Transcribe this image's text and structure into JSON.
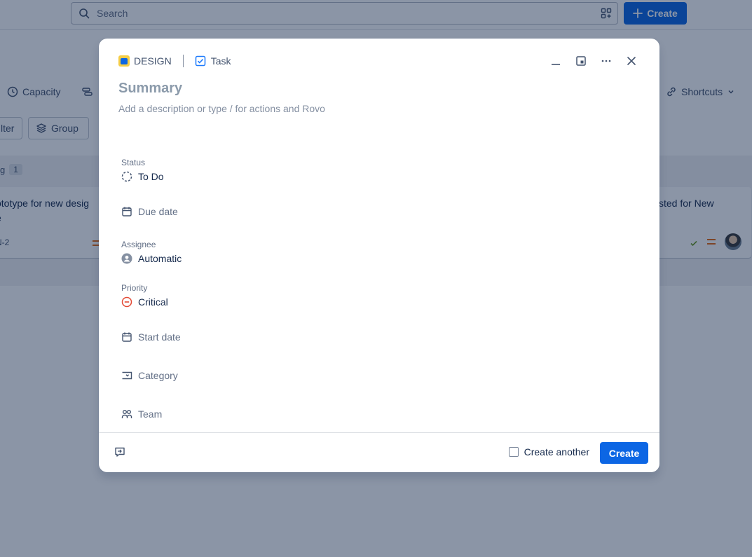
{
  "topbar": {
    "search_placeholder": "Search",
    "create_label": "Create"
  },
  "background": {
    "capacity_label": "Capacity",
    "shortcuts_label": "Shortcuts",
    "filter_label": "lter",
    "group_label": "Group",
    "column_label": "g",
    "column_count": "1",
    "card_left": {
      "line1": "ototype for new desig",
      "line2": "e",
      "key": "N-2"
    },
    "card_right": {
      "line1": "sted for New"
    }
  },
  "modal": {
    "project_name": "DESIGN",
    "issue_type": "Task",
    "summary_placeholder": "Summary",
    "description_placeholder": "Add a description or type / for actions and Rovo",
    "fields": {
      "status": {
        "label": "Status",
        "value": "To Do"
      },
      "due_date": {
        "value": "Due date"
      },
      "assignee": {
        "label": "Assignee",
        "value": "Automatic"
      },
      "priority": {
        "label": "Priority",
        "value": "Critical"
      },
      "start_date": {
        "value": "Start date"
      },
      "category": {
        "value": "Category"
      },
      "team": {
        "value": "Team"
      }
    },
    "footer": {
      "create_another_label": "Create another",
      "create_label": "Create"
    }
  },
  "colors": {
    "brand_blue": "#0c66e4",
    "priority_critical": "#e34935",
    "priority_medium": "#e56910",
    "project_yellow": "#f5cd47"
  }
}
